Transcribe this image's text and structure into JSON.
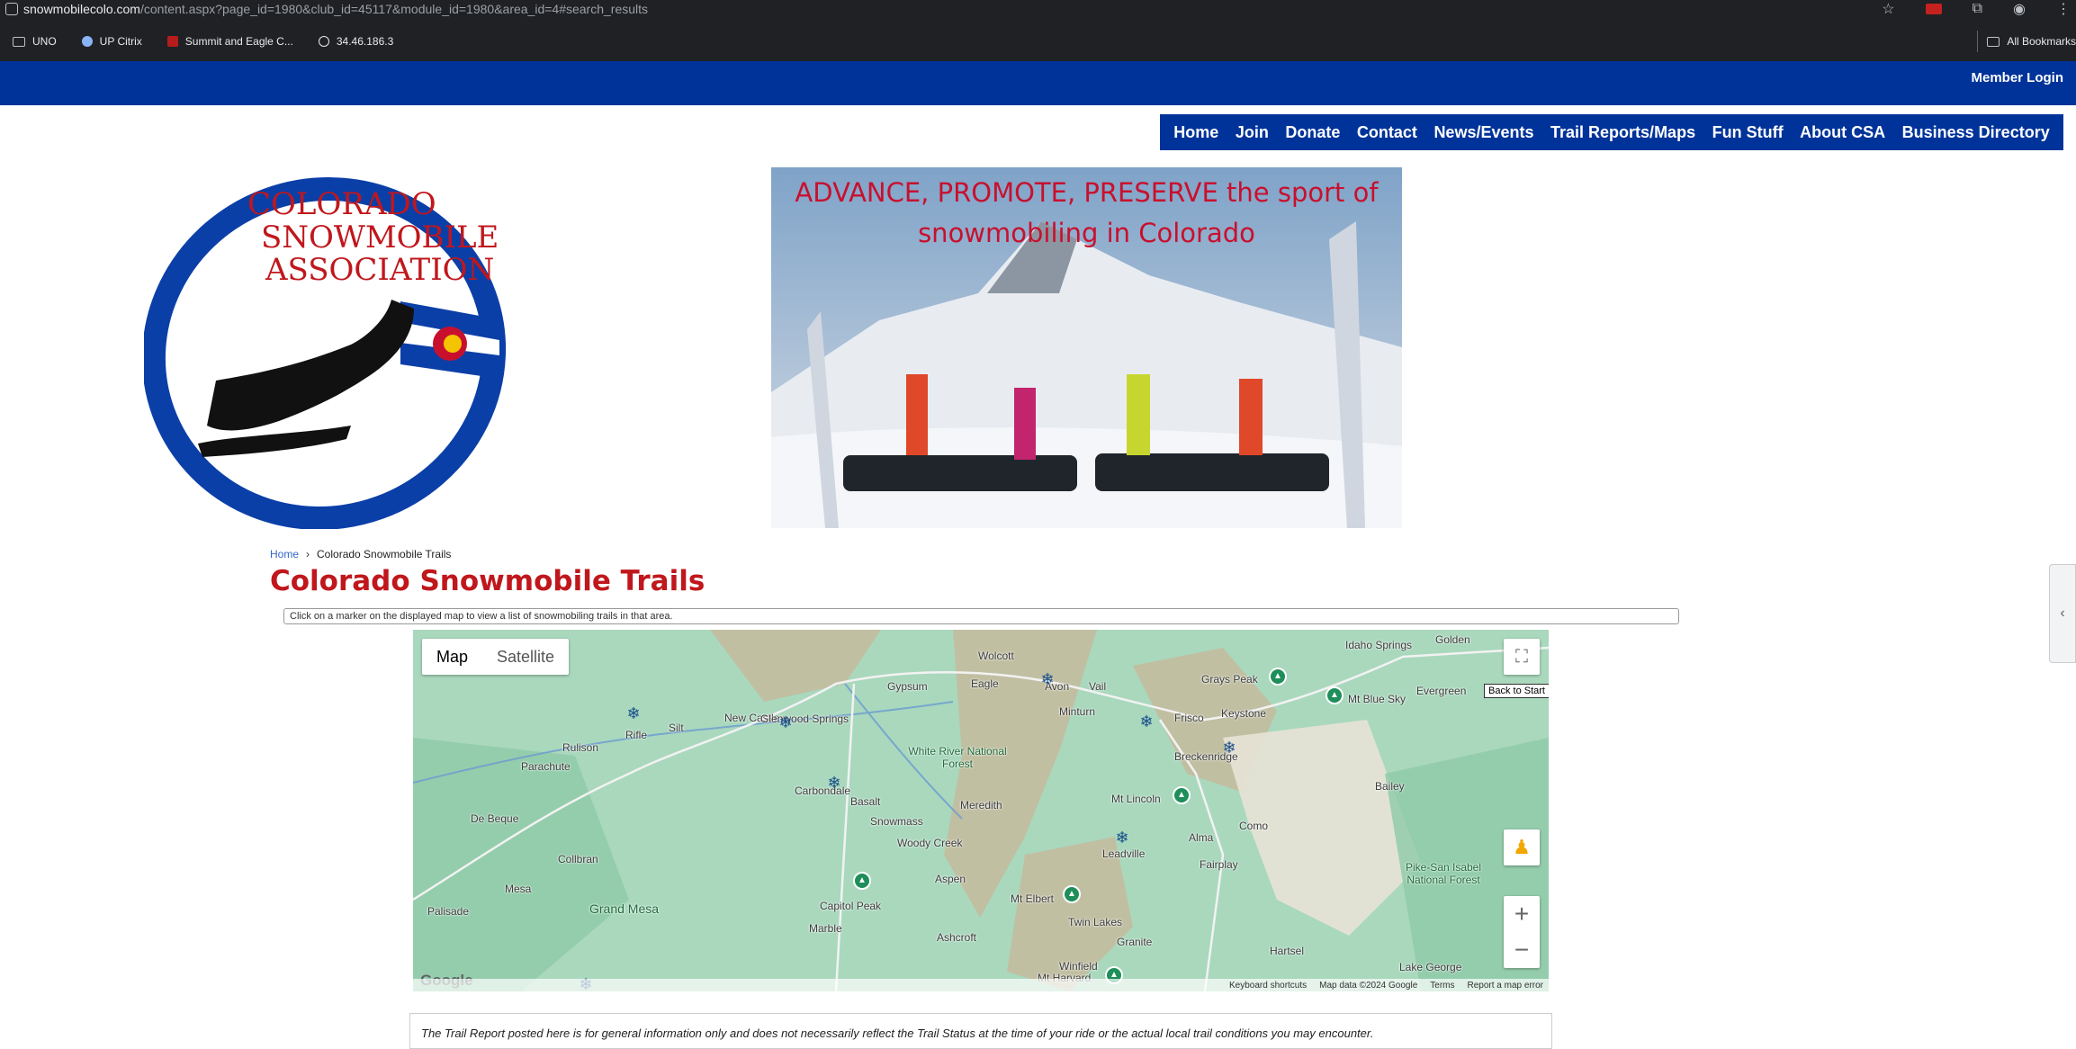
{
  "browser": {
    "url_host": "snowmobilecolo.com",
    "url_path": "/content.aspx?page_id=1980&club_id=45117&module_id=1980&area_id=4#search_results",
    "bookmarks": [
      "UNO",
      "UP Citrix",
      "Summit and Eagle C...",
      "34.46.186.3"
    ],
    "all_bookmarks": "All Bookmarks"
  },
  "site": {
    "member_login": "Member Login",
    "nav": [
      "Home",
      "Join",
      "Donate",
      "Contact",
      "News/Events",
      "Trail Reports/Maps",
      "Fun Stuff",
      "About CSA",
      "Business Directory"
    ],
    "logo_lines": [
      "COLORADO",
      "SNOWMOBILE",
      "ASSOCIATION"
    ],
    "banner_line1": "ADVANCE, PROMOTE, PRESERVE the sport of",
    "banner_line2": "snowmobiling in Colorado",
    "colors": {
      "brand_blue": "#003399",
      "title_red": "#c0171c",
      "banner_red": "#c8102e"
    }
  },
  "breadcrumb": {
    "home": "Home",
    "separator": "›",
    "current": "Colorado Snowmobile Trails"
  },
  "page_title": "Colorado Snowmobile Trails",
  "hint": "Click on a marker on the displayed map to view a list of snowmobiling trails in that area.",
  "map": {
    "tab_map": "Map",
    "tab_satellite": "Satellite",
    "back_to_start": "Back to Start",
    "google": "Google",
    "footer": [
      "Keyboard shortcuts",
      "Map data ©2024 Google",
      "Terms",
      "Report a map error"
    ],
    "places": [
      "Wolcott",
      "Gypsum",
      "Eagle",
      "Avon",
      "Vail",
      "Minturn",
      "Frisco",
      "Keystone",
      "Grays Peak",
      "Idaho Springs",
      "Golden",
      "Mt Blue Sky",
      "Evergreen",
      "New Castle",
      "Glenwood Springs",
      "Silt",
      "Rifle",
      "Rulison",
      "Parachute",
      "De Beque",
      "Carbondale",
      "Basalt",
      "White River National Forest",
      "Snowmass",
      "Meredith",
      "Woody Creek",
      "Breckenridge",
      "Mt Lincoln",
      "Alma",
      "Como",
      "Bailey",
      "Leadville",
      "Fairplay",
      "Collbran",
      "Mesa",
      "Palisade",
      "Grand Mesa",
      "Capitol Peak",
      "Aspen",
      "Mt Elbert",
      "Twin Lakes",
      "Marble",
      "Ashcroft",
      "Granite",
      "Hartsel",
      "Pike-San Isabel National Forest",
      "Lake George",
      "Winfield",
      "Mt Harvard"
    ]
  },
  "disclaimer": "The Trail Report posted here is for general information only and does not necessarily reflect the Trail Status at the time of your ride or the actual local trail conditions you may encounter."
}
